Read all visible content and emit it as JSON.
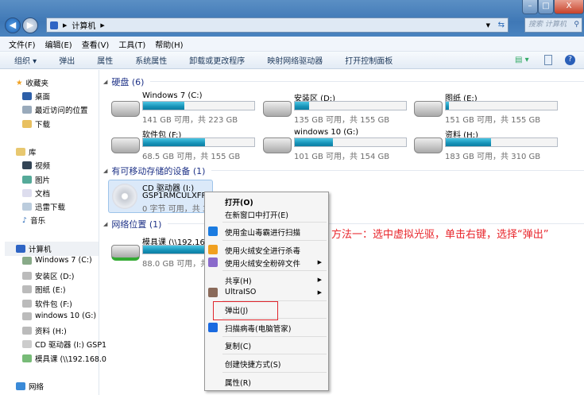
{
  "window": {
    "minimize": "–",
    "maximize": "□",
    "close": "X"
  },
  "address": {
    "crumb": "计算机",
    "search_placeholder": "搜索 计算机"
  },
  "menu": [
    "文件(F)",
    "编辑(E)",
    "查看(V)",
    "工具(T)",
    "帮助(H)"
  ],
  "toolbar": [
    "组织 ▾",
    "弹出",
    "属性",
    "系统属性",
    "卸载或更改程序",
    "映射网络驱动器",
    "打开控制面板"
  ],
  "sidebar": {
    "favorites": {
      "label": "收藏夹",
      "items": [
        "桌面",
        "最近访问的位置",
        "下载"
      ]
    },
    "libraries": {
      "label": "库",
      "items": [
        "视频",
        "图片",
        "文档",
        "迅雷下载",
        "音乐"
      ]
    },
    "computer": {
      "label": "计算机",
      "items": [
        "Windows 7 (C:)",
        "安装区 (D:)",
        "图纸 (E:)",
        "软件包 (F:)",
        "windows 10 (G:)",
        "资料 (H:)",
        "CD 驱动器 (I:) GSP1",
        "模具课 (\\\\192.168.0"
      ]
    },
    "network": {
      "label": "网络"
    }
  },
  "sections": {
    "hdd": "硬盘 (6)",
    "removable": "有可移动存储的设备 (1)",
    "network": "网络位置 (1)"
  },
  "drives": [
    {
      "name": "Windows 7 (C:)",
      "info": "141 GB 可用，共 223 GB",
      "used": 0.37
    },
    {
      "name": "安装区 (D:)",
      "info": "135 GB 可用，共 155 GB",
      "used": 0.13
    },
    {
      "name": "图纸 (E:)",
      "info": "151 GB 可用，共 155 GB",
      "used": 0.03
    },
    {
      "name": "软件包 (F:)",
      "info": "68.5 GB 可用，共 155 GB",
      "used": 0.56
    },
    {
      "name": "windows 10 (G:)",
      "info": "101 GB 可用，共 154 GB",
      "used": 0.34
    },
    {
      "name": "资料 (H:)",
      "info": "183 GB 可用，共 310 GB",
      "used": 0.41
    }
  ],
  "cd": {
    "name": "CD 驱动器 (I:)",
    "label": "GSP1RMCULXFRE",
    "info": "0 字节 可用，共 3."
  },
  "netdrive": {
    "name": "模具课 (\\\\192.168.",
    "info": "88.0 GB 可用，共",
    "used": 0.9
  },
  "context_menu": [
    "打开(O)",
    "在新窗口中打开(E)",
    "使用金山毒霸进行扫描",
    "使用火绒安全进行杀毒",
    "使用火绒安全粉碎文件",
    "共享(H)",
    "UltraISO",
    "弹出(J)",
    "扫描病毒(电脑管家)",
    "复制(C)",
    "创建快捷方式(S)",
    "属性(R)"
  ],
  "annotation": "方法一：选中虚拟光驱，单击右键，选择“弹出”"
}
